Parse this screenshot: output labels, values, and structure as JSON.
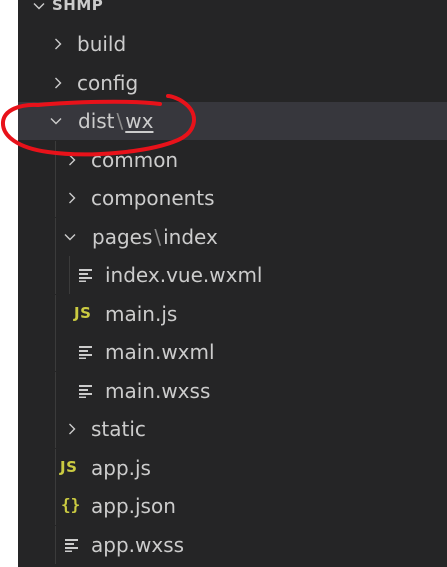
{
  "explorer": {
    "root": {
      "label": "SHMP",
      "expanded": true
    },
    "items": [
      {
        "label": "build",
        "type": "folder",
        "expanded": false
      },
      {
        "label": "config",
        "type": "folder",
        "expanded": false
      },
      {
        "label_a": "dist",
        "label_b": "wx",
        "type": "folder",
        "expanded": true,
        "selected": true
      },
      {
        "label": "common",
        "type": "folder",
        "expanded": false
      },
      {
        "label": "components",
        "type": "folder",
        "expanded": false
      },
      {
        "label_a": "pages",
        "label_b": "index",
        "type": "folder",
        "expanded": true
      },
      {
        "label": "index.vue.wxml",
        "type": "file",
        "icon": "lines-icon"
      },
      {
        "label": "main.js",
        "type": "file",
        "icon": "js-icon",
        "icon_text": "JS"
      },
      {
        "label": "main.wxml",
        "type": "file",
        "icon": "lines-icon"
      },
      {
        "label": "main.wxss",
        "type": "file",
        "icon": "lines-icon"
      },
      {
        "label": "static",
        "type": "folder",
        "expanded": false
      },
      {
        "label": "app.js",
        "type": "file",
        "icon": "js-icon",
        "icon_text": "JS"
      },
      {
        "label": "app.json",
        "type": "file",
        "icon": "json-icon",
        "icon_text": "{}"
      },
      {
        "label": "app.wxss",
        "type": "file",
        "icon": "lines-icon"
      }
    ],
    "path_separator": "\\"
  },
  "colors": {
    "background": "#252526",
    "selected_row": "#37373d",
    "text": "#cccccc",
    "js_icon": "#cbcb41",
    "annotation": "#e8121a"
  }
}
